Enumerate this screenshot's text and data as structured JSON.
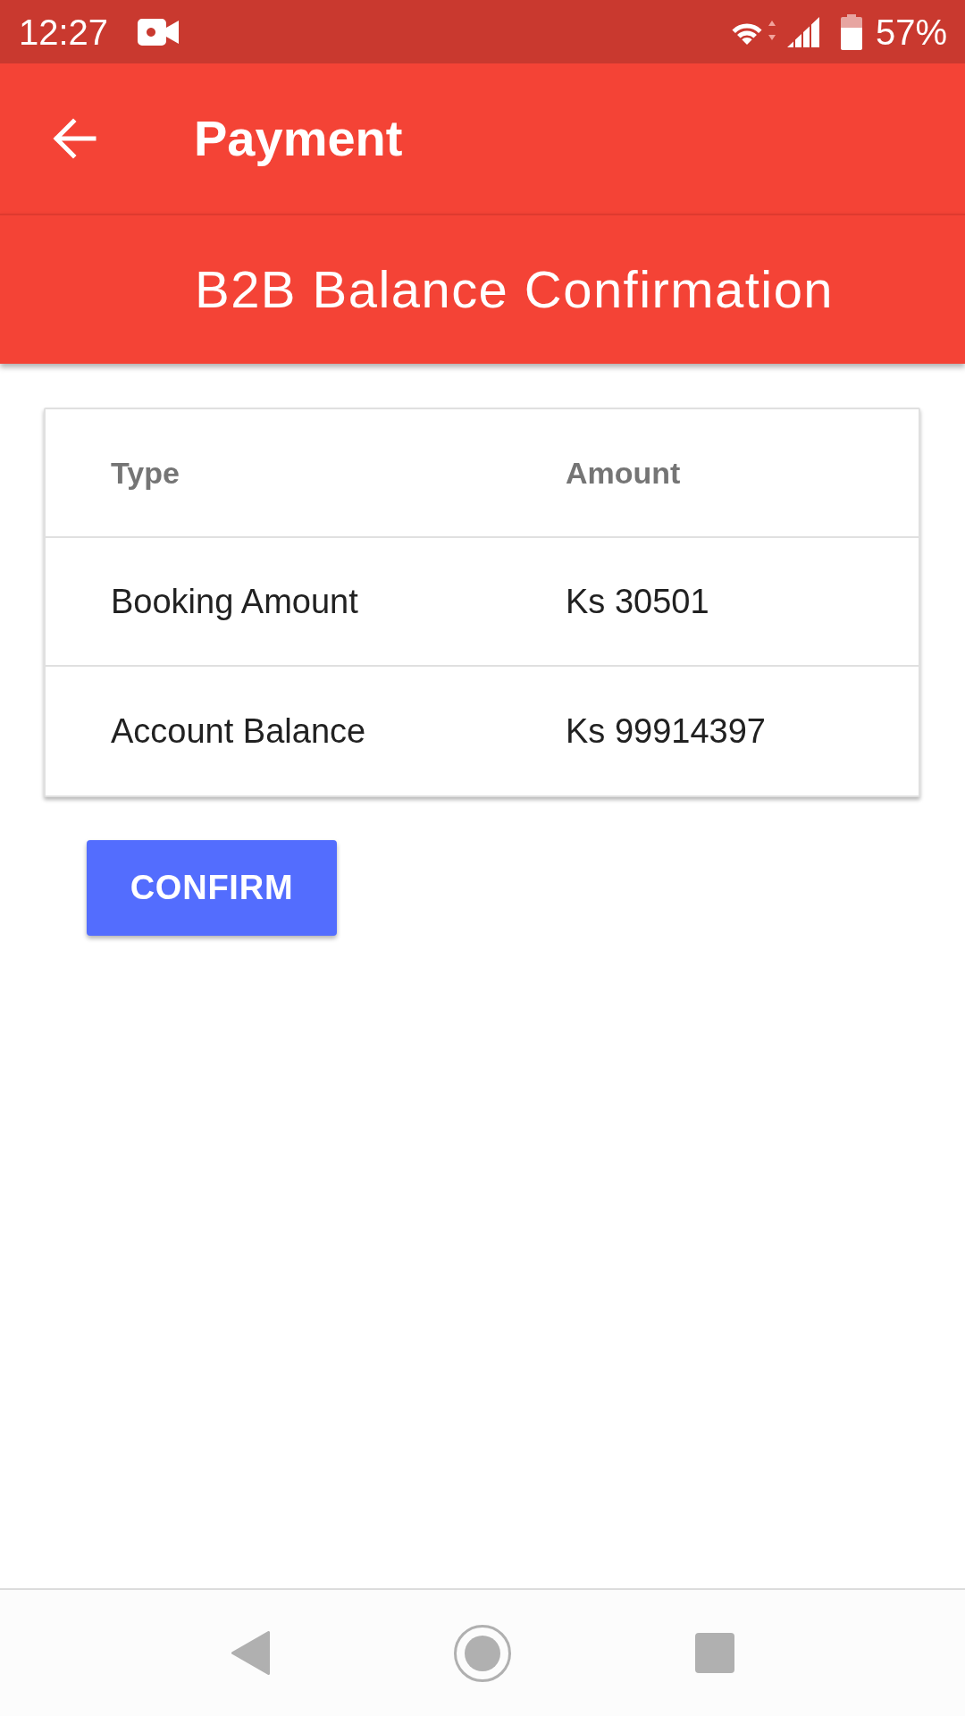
{
  "status_bar": {
    "time": "12:27",
    "battery": "57%"
  },
  "toolbar": {
    "title": "Payment"
  },
  "subtitle": "B2B Balance Confirmation",
  "table": {
    "columns": [
      "Type",
      "Amount"
    ],
    "rows": [
      [
        "Booking Amount",
        "Ks 30501"
      ],
      [
        "Account Balance",
        "Ks 99914397"
      ]
    ]
  },
  "confirm_button": {
    "label": "CONFIRM"
  }
}
